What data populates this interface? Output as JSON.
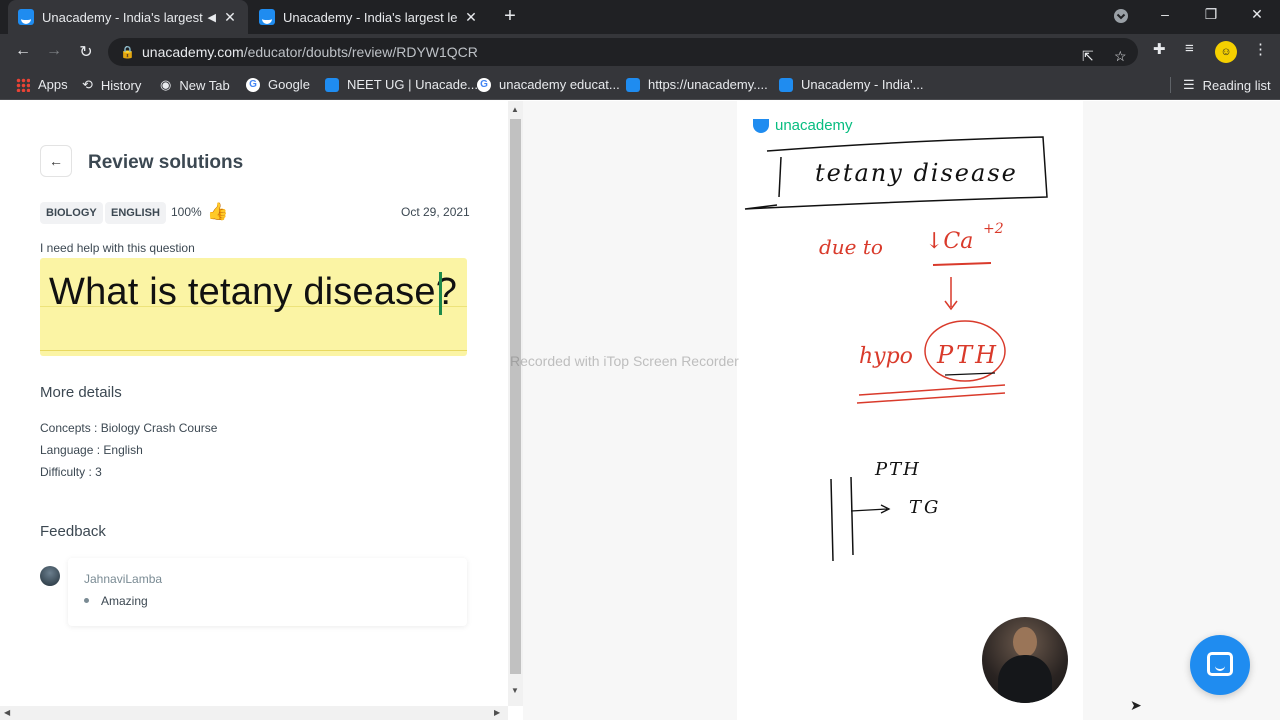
{
  "browser": {
    "tabs": [
      {
        "title": "Unacademy - India's largest l",
        "active": true,
        "muted_icon": "speaker-icon"
      },
      {
        "title": "Unacademy - India's largest learn",
        "active": false
      }
    ],
    "new_tab_symbol": "+",
    "window_controls": {
      "minimize": "–",
      "restore": "❐",
      "close": "✕"
    },
    "url": {
      "host": "unacademy.com",
      "path": "/educator/doubts/review/RDYW1QCR"
    },
    "bookmarks": [
      {
        "label": "Apps",
        "icon": "apps-grid-icon"
      },
      {
        "label": "History",
        "icon": "history-icon"
      },
      {
        "label": "New Tab",
        "icon": "globe-icon"
      },
      {
        "label": "Google",
        "icon": "google-icon"
      },
      {
        "label": "NEET UG | Unacade...",
        "icon": "unacademy-icon"
      },
      {
        "label": "unacademy educat...",
        "icon": "google-icon"
      },
      {
        "label": "https://unacademy....",
        "icon": "unacademy-icon"
      },
      {
        "label": "Unacademy - India'...",
        "icon": "unacademy-icon"
      }
    ],
    "reading_list": "Reading list",
    "profile_initial": "☺"
  },
  "review": {
    "title": "Review solutions",
    "back_symbol": "←",
    "tags": [
      "BIOLOGY",
      "ENGLISH"
    ],
    "rating": "100%",
    "rating_icon": "👍",
    "date": "Oct 29, 2021",
    "help_label": "I need help with this question",
    "question": "What is tetany disease?",
    "more_details_heading": "More details",
    "details": {
      "concepts": "Concepts : Biology Crash Course",
      "language": "Language : English",
      "difficulty": "Difficulty : 3"
    },
    "feedback_heading": "Feedback",
    "feedback": {
      "user": "JahnaviLamba",
      "comment": "Amazing"
    }
  },
  "board": {
    "logo_text": "unacademy",
    "handwriting": {
      "title": "tetany disease",
      "line1": "due to",
      "line1b": "↓Ca",
      "line1sup": "+2",
      "line2": "hypo",
      "line2b": "PTH",
      "line3": "PTH",
      "line4": "TG"
    },
    "watermark": "Recorded with iTop Screen Recorder"
  },
  "colors": {
    "accent": "#08bd80",
    "brand_blue": "#1f8cf0",
    "ink_red": "#d93a2b",
    "highlight": "#fbf4a4"
  }
}
